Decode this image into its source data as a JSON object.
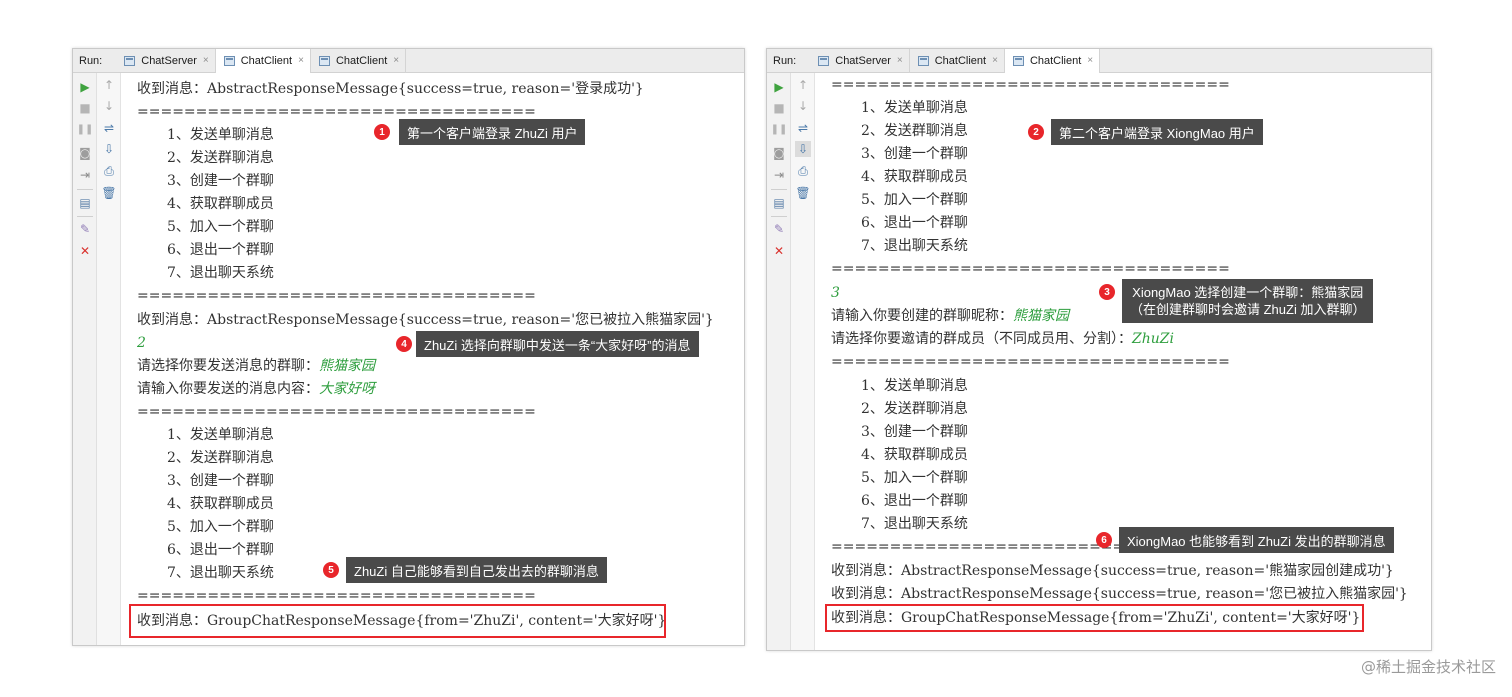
{
  "left": {
    "run_label": "Run:",
    "tabs": [
      {
        "label": "ChatServer",
        "close": "×"
      },
      {
        "label": "ChatClient",
        "close": "×"
      },
      {
        "label": "ChatClient",
        "close": "×"
      }
    ],
    "lines": [
      "收到消息：AbstractResponseMessage{success=true, reason='登录成功'}",
      "==================================",
      "1、发送单聊消息",
      "2、发送群聊消息",
      "3、创建一个群聊",
      "4、获取群聊成员",
      "5、加入一个群聊",
      "6、退出一个群聊",
      "7、退出聊天系统",
      "==================================",
      "收到消息：AbstractResponseMessage{success=true, reason='您已被拉入熊猫家园'}",
      "2",
      "请选择你要发送消息的群聊：",
      "熊猫家园",
      "请输入你要发送的消息内容：",
      "大家好呀",
      "==================================",
      "1、发送单聊消息",
      "2、发送群聊消息",
      "3、创建一个群聊",
      "4、获取群聊成员",
      "5、加入一个群聊",
      "6、退出一个群聊",
      "7、退出聊天系统",
      "==================================",
      "收到消息：GroupChatResponseMessage{from='ZhuZi', content='大家好呀'}"
    ],
    "callouts": [
      {
        "num": "1",
        "text": "第一个客户端登录 ZhuZi 用户"
      },
      {
        "num": "4",
        "text": "ZhuZi 选择向群聊中发送一条“大家好呀”的消息"
      },
      {
        "num": "5",
        "text": "ZhuZi 自己能够看到自己发出去的群聊消息"
      }
    ]
  },
  "right": {
    "run_label": "Run:",
    "tabs": [
      {
        "label": "ChatServer",
        "close": "×"
      },
      {
        "label": "ChatClient",
        "close": "×"
      },
      {
        "label": "ChatClient",
        "close": "×"
      }
    ],
    "lines": [
      "==================================",
      "1、发送单聊消息",
      "2、发送群聊消息",
      "3、创建一个群聊",
      "4、获取群聊成员",
      "5、加入一个群聊",
      "6、退出一个群聊",
      "7、退出聊天系统",
      "==================================",
      "3",
      "请输入你要创建的群聊昵称：",
      "熊猫家园",
      "请选择你要邀请的群成员（不同成员用、分割）：",
      "ZhuZi",
      "==================================",
      "1、发送单聊消息",
      "2、发送群聊消息",
      "3、创建一个群聊",
      "4、获取群聊成员",
      "5、加入一个群聊",
      "6、退出一个群聊",
      "7、退出聊天系统",
      "==================================",
      "收到消息：AbstractResponseMessage{success=true, reason='熊猫家园创建成功'}",
      "收到消息：AbstractResponseMessage{success=true, reason='您已被拉入熊猫家园'}",
      "收到消息：GroupChatResponseMessage{from='ZhuZi', content='大家好呀'}"
    ],
    "callouts": [
      {
        "num": "2",
        "text": "第二个客户端登录 XiongMao 用户"
      },
      {
        "num": "3",
        "text": "XiongMao 选择创建一个群聊：熊猫家园",
        "text2": "（在创建群聊时会邀请 ZhuZi 加入群聊）"
      },
      {
        "num": "6",
        "text": "XiongMao 也能够看到 ZhuZi 发出的群聊消息"
      }
    ]
  },
  "watermark": "@稀土掘金技术社区",
  "colors": {
    "accent_red": "#e8262b",
    "callout_bg": "#4a4a4a",
    "user_input_green": "#2e9e3e"
  },
  "icons": [
    "run-icon",
    "stop-icon",
    "pause-icon",
    "camera-icon",
    "exit-icon",
    "layout-icon",
    "pin-icon",
    "close-icon",
    "up-arrow-icon",
    "down-arrow-icon",
    "wrap-icon",
    "scroll-icon",
    "print-icon",
    "trash-icon"
  ]
}
